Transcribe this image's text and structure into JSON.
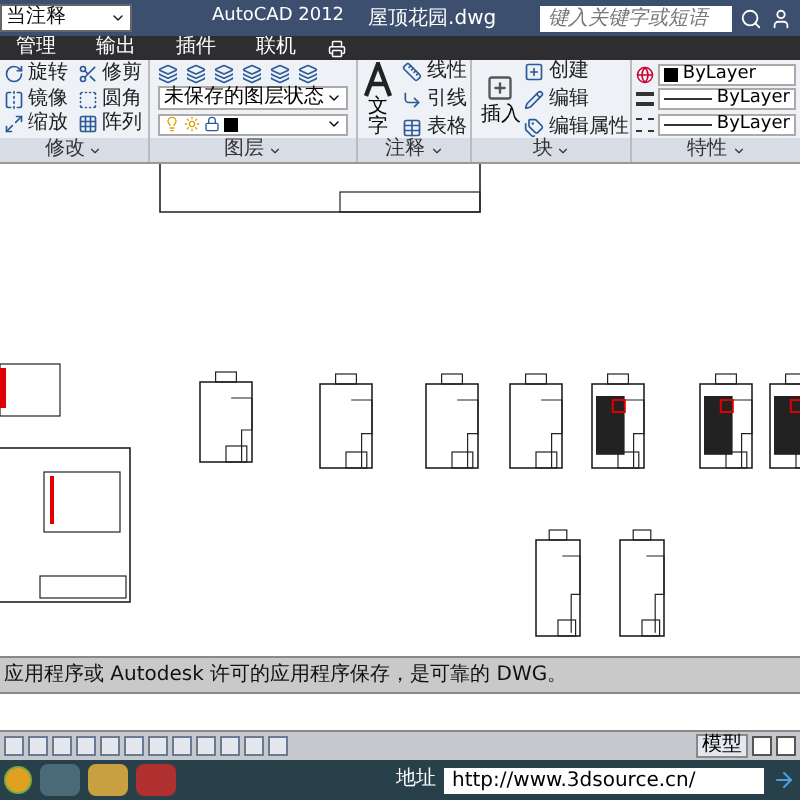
{
  "title_bar": {
    "workspace": "当注释",
    "app_title": "AutoCAD 2012",
    "file_name": "屋顶花园.dwg",
    "search": {
      "placeholder": "键入关键字或短语"
    }
  },
  "ribbon_tabs": [
    {
      "label": "管理",
      "selected": false
    },
    {
      "label": "输出",
      "selected": false
    },
    {
      "label": "插件",
      "selected": false
    },
    {
      "label": "联机",
      "selected": false
    }
  ],
  "modify_panel": {
    "title": "修改",
    "tools": [
      {
        "label": "旋转",
        "kind": "rotate"
      },
      {
        "label": "修剪",
        "kind": "trim"
      },
      {
        "label": "镜像",
        "kind": "mirror"
      },
      {
        "label": "圆角",
        "kind": "fillet"
      },
      {
        "label": "缩放",
        "kind": "scale"
      },
      {
        "label": "阵列",
        "kind": "array"
      }
    ]
  },
  "layers_panel": {
    "title": "图层",
    "layer_state": "未保存的图层状态"
  },
  "annotation_panel": {
    "title": "注释",
    "main_tool": "文字",
    "tools": [
      {
        "label": "线性",
        "kind": "linear"
      },
      {
        "label": "引线",
        "kind": "leader"
      },
      {
        "label": "表格",
        "kind": "table"
      }
    ]
  },
  "block_panel": {
    "title": "块",
    "main_tool": "插入",
    "tools": [
      {
        "label": "创建",
        "kind": "create"
      },
      {
        "label": "编辑",
        "kind": "edit"
      },
      {
        "label": "编辑属性",
        "kind": "attribute"
      }
    ]
  },
  "properties_panel": {
    "title": "特性",
    "color_setting": "ByLayer",
    "linetype": "ByLayer",
    "lineweight": "ByLayer"
  },
  "command_line": {
    "history": "应用程序或 Autodesk 许可的应用程序保存，是可靠的 DWG。"
  },
  "status_bar": {
    "space": "模型"
  },
  "taskbar": {
    "address_label": "地址",
    "address": "http://www.3dsource.cn/"
  }
}
